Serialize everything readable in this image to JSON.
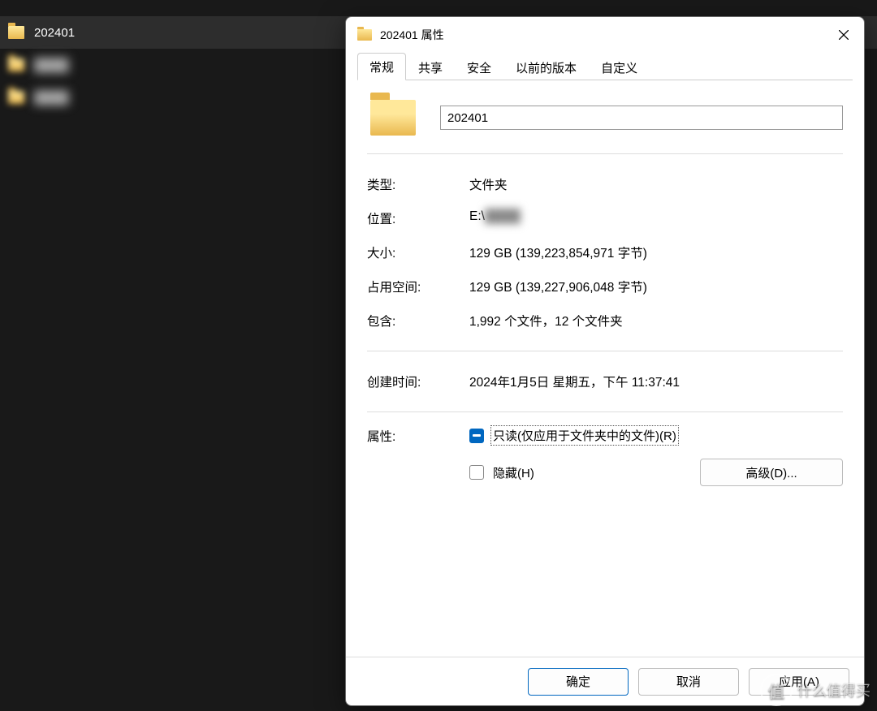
{
  "explorer": {
    "items": [
      {
        "name": "202401",
        "selected": true
      },
      {
        "name": "████",
        "blur": true
      },
      {
        "name": "████",
        "blur": true
      }
    ]
  },
  "dialog": {
    "title": "202401 属性",
    "tabs": {
      "general": "常规",
      "share": "共享",
      "security": "安全",
      "previous": "以前的版本",
      "custom": "自定义"
    },
    "folder_name": "202401",
    "labels": {
      "type": "类型:",
      "location": "位置:",
      "size": "大小:",
      "size_on_disk": "占用空间:",
      "contains": "包含:",
      "created": "创建时间:",
      "attributes": "属性:"
    },
    "values": {
      "type": "文件夹",
      "location_prefix": "E:\\",
      "location_hidden": "████",
      "size": "129 GB (139,223,854,971 字节)",
      "size_on_disk": "129 GB (139,227,906,048 字节)",
      "contains": "1,992 个文件，12 个文件夹",
      "created": "2024年1月5日 星期五，下午 11:37:41"
    },
    "attrs": {
      "readonly_label": "只读(仅应用于文件夹中的文件)(R)",
      "hidden_label": "隐藏(H)",
      "advanced_btn": "高级(D)..."
    },
    "buttons": {
      "ok": "确定",
      "cancel": "取消",
      "apply": "应用(A)"
    }
  },
  "watermark": {
    "text": "什么值得买",
    "badge": "值"
  }
}
